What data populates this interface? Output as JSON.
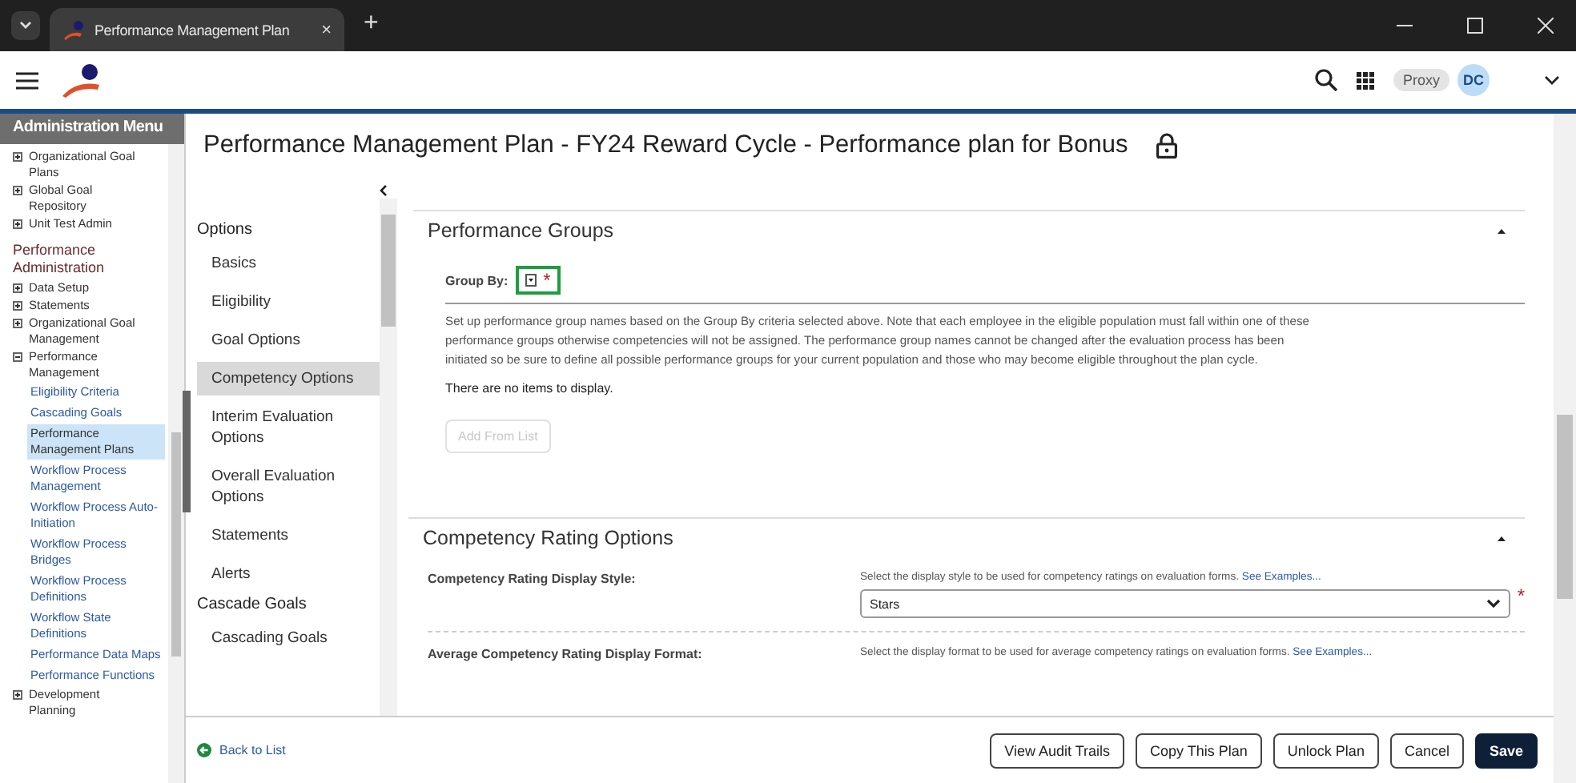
{
  "browser": {
    "tab_title": "Performance Management Plan",
    "tab_close": "×",
    "new_tab": "+"
  },
  "header": {
    "proxy": "Proxy",
    "avatar": "DC"
  },
  "admin_menu": {
    "title": "Administration Menu",
    "items": [
      {
        "kind": "node",
        "label": "Organizational Goal Plans",
        "expanded": false
      },
      {
        "kind": "node",
        "label": "Global Goal Repository",
        "expanded": false
      },
      {
        "kind": "node",
        "label": "Unit Test Admin",
        "expanded": false
      },
      {
        "kind": "heading",
        "label": "Performance Administration"
      },
      {
        "kind": "node",
        "label": "Data Setup",
        "expanded": false
      },
      {
        "kind": "node",
        "label": "Statements",
        "expanded": false
      },
      {
        "kind": "node",
        "label": "Organizational Goal Management",
        "expanded": false
      },
      {
        "kind": "node",
        "label": "Performance Management",
        "expanded": true,
        "children": [
          {
            "label": "Eligibility Criteria",
            "selected": false
          },
          {
            "label": "Cascading Goals",
            "selected": false
          },
          {
            "label": "Performance Management Plans",
            "selected": true
          },
          {
            "label": "Workflow Process Management",
            "selected": false
          },
          {
            "label": "Workflow Process Auto-Initiation",
            "selected": false
          },
          {
            "label": "Workflow Process Bridges",
            "selected": false
          },
          {
            "label": "Workflow Process Definitions",
            "selected": false
          },
          {
            "label": "Workflow State Definitions",
            "selected": false
          },
          {
            "label": "Performance Data Maps",
            "selected": false
          },
          {
            "label": "Performance Functions",
            "selected": false
          }
        ]
      },
      {
        "kind": "node",
        "label": "Development Planning",
        "expanded": false
      }
    ]
  },
  "page_title": "Performance Management Plan - FY24 Reward Cycle - Performance plan for Bonus",
  "options_nav": [
    {
      "heading": "Options",
      "items": [
        {
          "label": "Basics",
          "selected": false
        },
        {
          "label": "Eligibility",
          "selected": false
        },
        {
          "label": "Goal Options",
          "selected": false
        },
        {
          "label": "Competency Options",
          "selected": true
        },
        {
          "label": "Interim Evaluation Options",
          "selected": false
        },
        {
          "label": "Overall Evaluation Options",
          "selected": false
        },
        {
          "label": "Statements",
          "selected": false
        },
        {
          "label": "Alerts",
          "selected": false
        }
      ]
    },
    {
      "heading": "Cascade Goals",
      "items": [
        {
          "label": "Cascading Goals",
          "selected": false
        }
      ]
    }
  ],
  "performance_groups": {
    "title": "Performance Groups",
    "expanded": true,
    "group_by_label": "Group By:",
    "required": "*",
    "description": "Set up performance group names based on the Group By criteria selected above. Note that each employee in the eligible population must fall within one of these performance groups otherwise competencies will not be assigned. The performance group names cannot be changed after the evaluation process has been initiated so be sure to define all possible performance groups for your current population and those who may become eligible throughout the plan cycle.",
    "empty_message": "There are no items to display.",
    "add_button": {
      "label": "Add From List",
      "disabled": true
    }
  },
  "competency_rating_options": {
    "title": "Competency Rating Options",
    "expanded": true,
    "fields": [
      {
        "label": "Competency Rating Display Style:",
        "hint": "Select the display style to be used for competency ratings on evaluation forms.",
        "link": "See Examples...",
        "value": "Stars",
        "required": "*"
      },
      {
        "label": "Average Competency Rating Display Format:",
        "hint": "Select the display format to be used for average competency ratings on evaluation forms.",
        "link": "See Examples..."
      }
    ]
  },
  "footer": {
    "back_link": "Back to List",
    "buttons": [
      {
        "label": "View Audit Trails",
        "kind": "secondary"
      },
      {
        "label": "Copy This Plan",
        "kind": "secondary"
      },
      {
        "label": "Unlock Plan",
        "kind": "secondary"
      },
      {
        "label": "Cancel",
        "kind": "secondary"
      },
      {
        "label": "Save",
        "kind": "primary"
      }
    ]
  }
}
